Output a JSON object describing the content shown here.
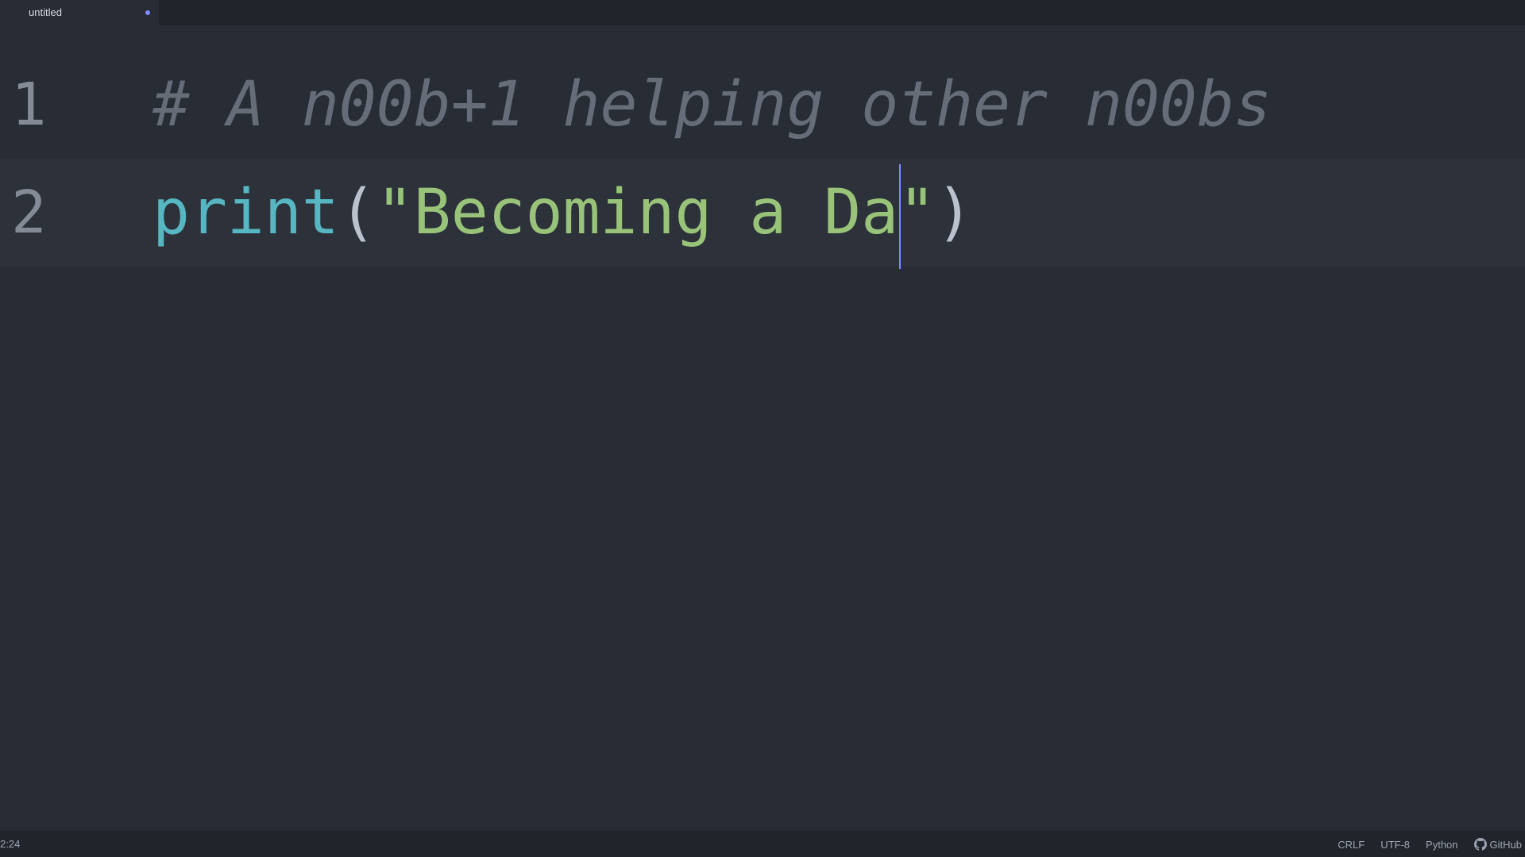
{
  "tab": {
    "title": "untitled",
    "modified": true
  },
  "editor": {
    "lines": [
      {
        "number": "1",
        "comment": "# A n00b+1 helping other n00bs"
      },
      {
        "number": "2",
        "func": "print",
        "open": "(",
        "string_before_cursor": "\"Becoming a Da",
        "string_after_cursor": "\"",
        "close": ")"
      }
    ]
  },
  "status_bar": {
    "cursor_position": "2:24",
    "line_ending": "CRLF",
    "encoding": "UTF-8",
    "grammar": "Python",
    "github": "GitHub"
  },
  "colors": {
    "background": "#282c34",
    "comment": "#666d78",
    "function": "#56b6c2",
    "string": "#98c379",
    "cursor": "#7f8cff"
  }
}
